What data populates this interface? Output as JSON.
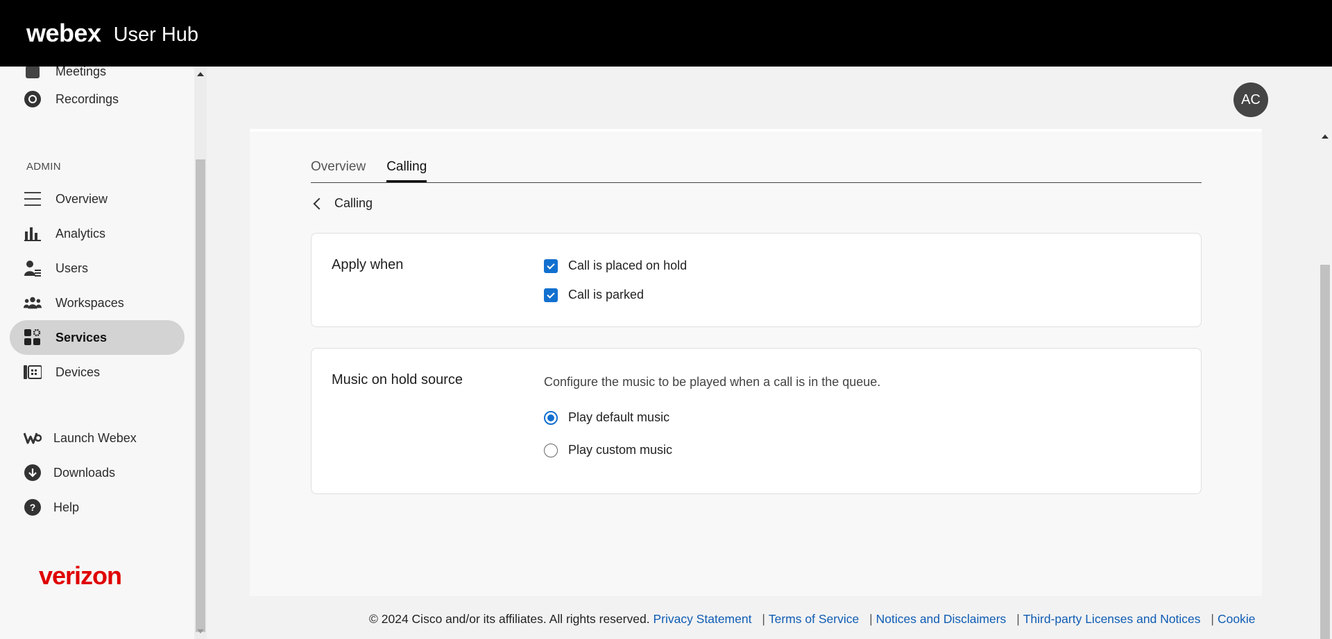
{
  "topbar": {
    "brand": "webex",
    "product": "User Hub"
  },
  "sidebar": {
    "top_items": [
      {
        "label": "Meetings",
        "icon": "calendar-icon"
      },
      {
        "label": "Recordings",
        "icon": "recording-icon"
      }
    ],
    "admin_label": "ADMIN",
    "admin_items": [
      {
        "label": "Overview",
        "icon": "overview-icon"
      },
      {
        "label": "Analytics",
        "icon": "analytics-icon"
      },
      {
        "label": "Users",
        "icon": "users-icon"
      },
      {
        "label": "Workspaces",
        "icon": "workspaces-icon"
      },
      {
        "label": "Services",
        "icon": "services-icon",
        "active": true
      },
      {
        "label": "Devices",
        "icon": "devices-icon"
      }
    ],
    "bottom_items": [
      {
        "label": "Launch Webex",
        "icon": "webex-logo-icon"
      },
      {
        "label": "Downloads",
        "icon": "download-icon"
      },
      {
        "label": "Help",
        "icon": "help-icon"
      }
    ],
    "partner_logo": "verizon"
  },
  "avatar": {
    "initials": "AC"
  },
  "tabs": [
    {
      "label": "Overview",
      "active": false
    },
    {
      "label": "Calling",
      "active": true
    }
  ],
  "back_link": "Calling",
  "apply_when": {
    "title": "Apply when",
    "options": [
      {
        "label": "Call is placed on hold",
        "checked": true
      },
      {
        "label": "Call is parked",
        "checked": true
      }
    ]
  },
  "music_source": {
    "title": "Music on hold source",
    "description": "Configure the music to be played when a call is in the queue.",
    "options": [
      {
        "label": "Play default music",
        "selected": true
      },
      {
        "label": "Play custom music",
        "selected": false
      }
    ]
  },
  "footer": {
    "copyright": "© 2024 Cisco and/or its affiliates. All rights reserved.",
    "links": [
      "Privacy Statement",
      "Terms of Service",
      "Notices and Disclaimers",
      "Third-party Licenses and Notices",
      "Cookie"
    ]
  },
  "colors": {
    "accent": "#1170cf",
    "topbar": "#000000",
    "link": "#0f5cb4",
    "verizon_red": "#e00000"
  }
}
